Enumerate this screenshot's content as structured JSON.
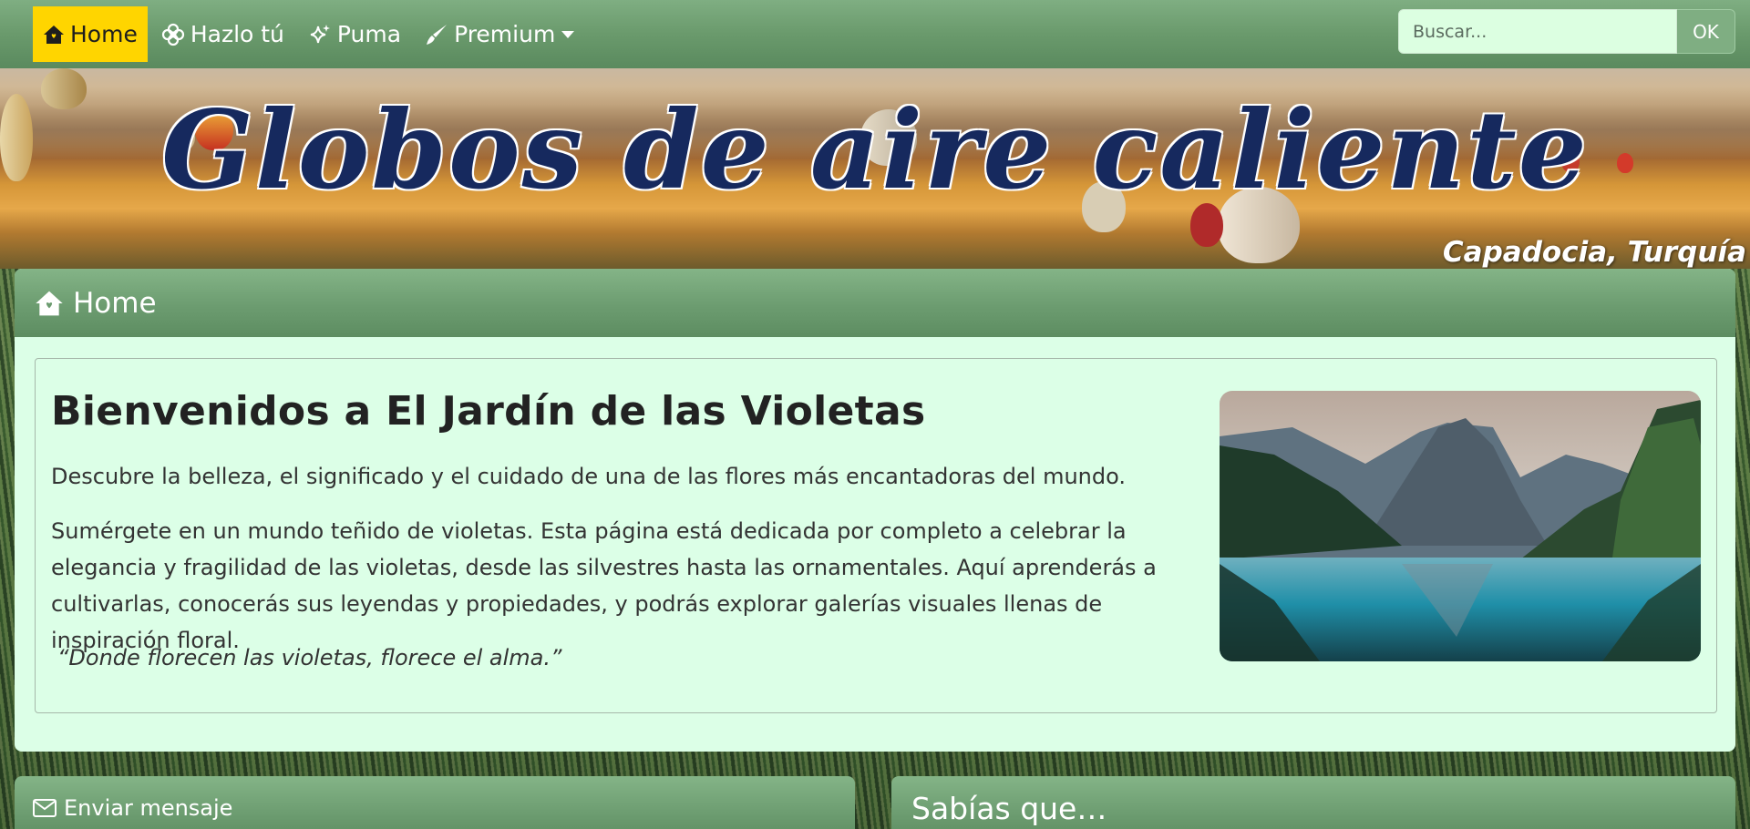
{
  "nav": {
    "items": [
      {
        "label": "Home",
        "icon": "house-icon",
        "active": true
      },
      {
        "label": "Hazlo tú",
        "icon": "flower-icon",
        "active": false
      },
      {
        "label": "Puma",
        "icon": "sparkles-icon",
        "active": false
      },
      {
        "label": "Premium",
        "icon": "brush-icon",
        "active": false,
        "dropdown": true
      }
    ],
    "search_placeholder": "Buscar...",
    "search_button": "OK"
  },
  "banner": {
    "title": "Globos de aire caliente",
    "subtitle": "Capadocia, Turquía"
  },
  "home_card": {
    "header": "Home",
    "welcome_title": "Bienvenidos a El Jardín de las Violetas",
    "intro": "Descubre la belleza, el significado y el cuidado de una de las flores más encantadoras del mundo.",
    "body": "Sumérgete en un mundo teñido de violetas. Esta página está dedicada por completo a celebrar la elegancia y fragilidad de las violetas, desde las silvestres hasta las ornamentales. Aquí aprenderás a cultivarlas, conocerás sus leyendas y propiedades, y podrás explorar galerías visuales llenas de inspiración floral.",
    "quote": "“Donde florecen las violetas, florece el alma.”"
  },
  "bottom_cards": {
    "message_header": "Enviar mensaje",
    "facts_header": "Sabías que…"
  },
  "colors": {
    "nav_green": "#6a9a6c",
    "active_yellow": "#ffd500",
    "card_bg": "#dcffe7",
    "title_navy": "#16295e"
  }
}
